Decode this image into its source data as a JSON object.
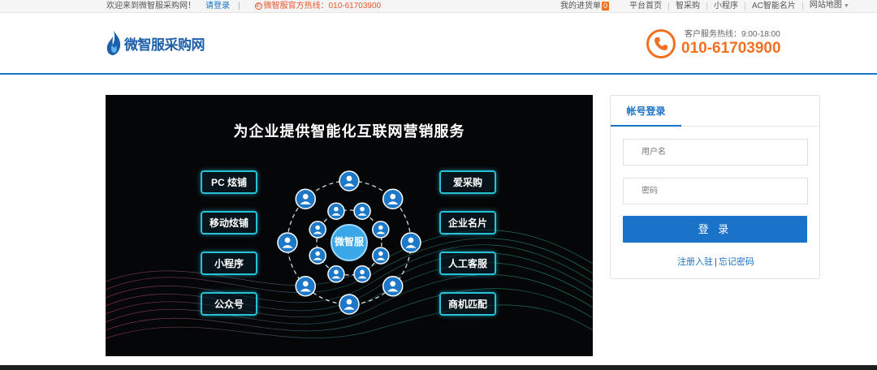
{
  "topbar": {
    "welcome": "欢迎来到微智服采购网！",
    "login_link": "请登录",
    "separator": "|",
    "hotline": "微智服官方热线：010-61703900",
    "cart_label": "我的进货单",
    "cart_count": "0",
    "nav": [
      "平台首页",
      "智采购",
      "小程序",
      "AC智能名片",
      "网站地图"
    ]
  },
  "header": {
    "logo_text": "微智服采购网",
    "service_hours": "客户服务热线：9:00-18:00",
    "service_number": "010-61703900"
  },
  "banner": {
    "headline": "为企业提供智能化互联网营销服务",
    "left_tags": [
      "PC 炫铺",
      "移动炫铺",
      "小程序",
      "公众号"
    ],
    "right_tags": [
      "爱采购",
      "企业名片",
      "人工客服",
      "商机匹配"
    ],
    "hub_label": "微智服"
  },
  "login": {
    "tab_label": "帐号登录",
    "username_placeholder": "用户名",
    "password_placeholder": "密码",
    "submit_label": "登 录",
    "register_link": "注册入驻",
    "links_separator": "|",
    "forgot_link": "忘记密码"
  },
  "colors": {
    "accent": "#1a73c8",
    "orange": "#f37021",
    "cyan": "#27c2d6"
  }
}
